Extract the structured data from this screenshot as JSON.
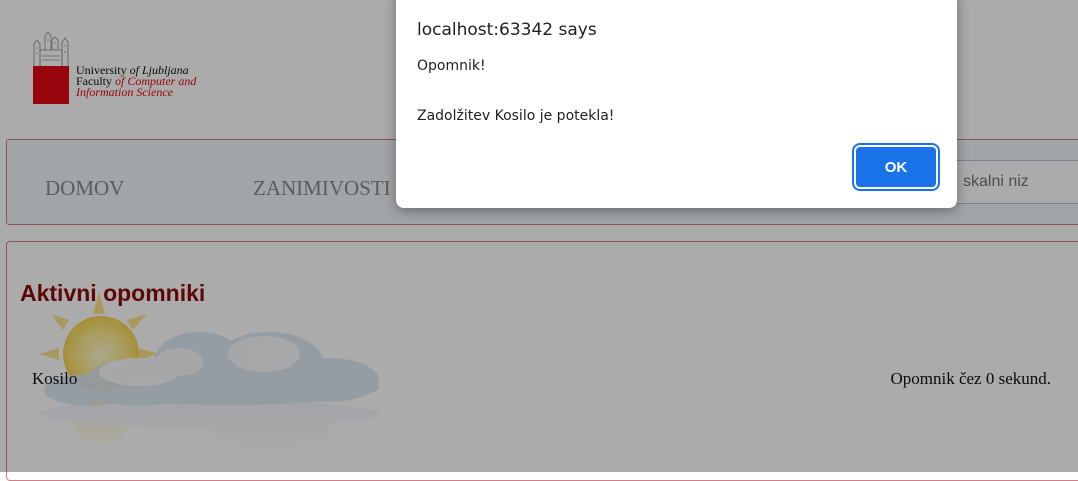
{
  "logo": {
    "line1_prefix": "University ",
    "line1_italic": "of Ljubljana",
    "line2_prefix": "Faculty ",
    "line2_italic": "of Computer and",
    "line3": "Information Science",
    "brand_color": "#e30613"
  },
  "nav": {
    "items": [
      {
        "label": "DOMOV"
      },
      {
        "label": "ZANIMIVOSTI"
      }
    ],
    "search": {
      "placeholder": "skalni niz"
    }
  },
  "content": {
    "title": "Aktivni opomniki",
    "reminder": {
      "name": "Kosilo",
      "time_text": "Opomnik čez 0 sekund."
    }
  },
  "dialog": {
    "title": "localhost:63342 says",
    "line1": "Opomnik!",
    "line2": "Zadolžitev Kosilo je potekla!",
    "ok_label": "OK",
    "accent": "#1a73e8"
  }
}
